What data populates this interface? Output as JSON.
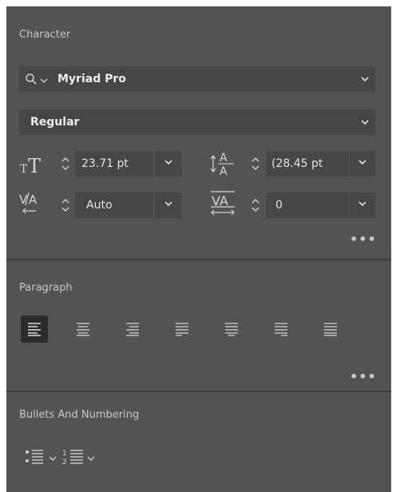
{
  "character": {
    "title": "Character",
    "font_family": "Myriad Pro",
    "font_style": "Regular",
    "font_size": "23.71 pt",
    "leading": "(28.45 pt",
    "kerning": "Auto",
    "tracking": "0",
    "more_label": "•••"
  },
  "paragraph": {
    "title": "Paragraph",
    "alignments": [
      {
        "name": "align-left",
        "active": true
      },
      {
        "name": "align-center",
        "active": false
      },
      {
        "name": "align-right",
        "active": false
      },
      {
        "name": "justify-last-left",
        "active": false
      },
      {
        "name": "justify-last-center",
        "active": false
      },
      {
        "name": "justify-last-right",
        "active": false
      },
      {
        "name": "justify-all",
        "active": false
      }
    ],
    "more_label": "•••"
  },
  "bullets": {
    "title": "Bullets And Numbering"
  },
  "colors": {
    "panel_bg": "#535353",
    "field_bg": "#464646",
    "divider": "#3c3c3c",
    "active_bg": "#2b2b2b"
  }
}
